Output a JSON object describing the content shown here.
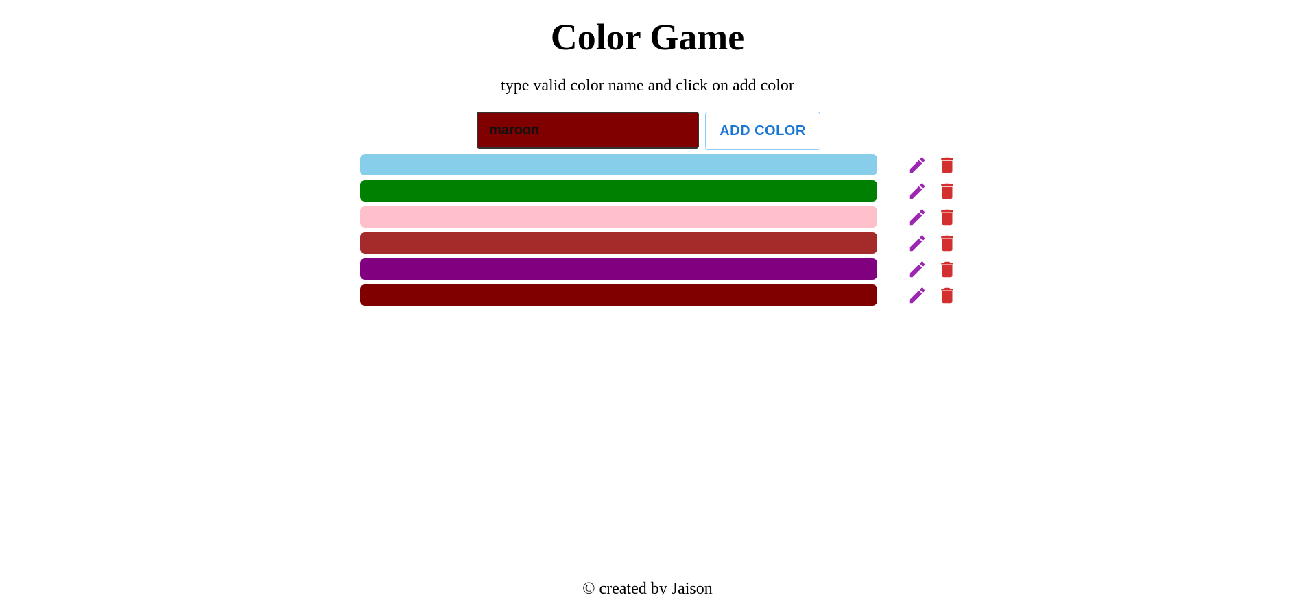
{
  "header": {
    "title": "Color Game",
    "instructions": "type valid color name and click on add color"
  },
  "form": {
    "input_value": "maroon",
    "input_bg_color": "#800000",
    "add_button_label": "ADD COLOR"
  },
  "colors": [
    {
      "name": "skyblue",
      "hex": "#87ceeb"
    },
    {
      "name": "green",
      "hex": "#008000"
    },
    {
      "name": "pink",
      "hex": "#ffc0cb"
    },
    {
      "name": "brown",
      "hex": "#a52a2a"
    },
    {
      "name": "purple",
      "hex": "#800080"
    },
    {
      "name": "maroon",
      "hex": "#800000"
    }
  ],
  "icons": {
    "edit": "pencil-icon",
    "delete": "trash-icon",
    "edit_color": "#9c27b0",
    "delete_color": "#d32f2f"
  },
  "footer": {
    "text": "© created by Jaison"
  }
}
